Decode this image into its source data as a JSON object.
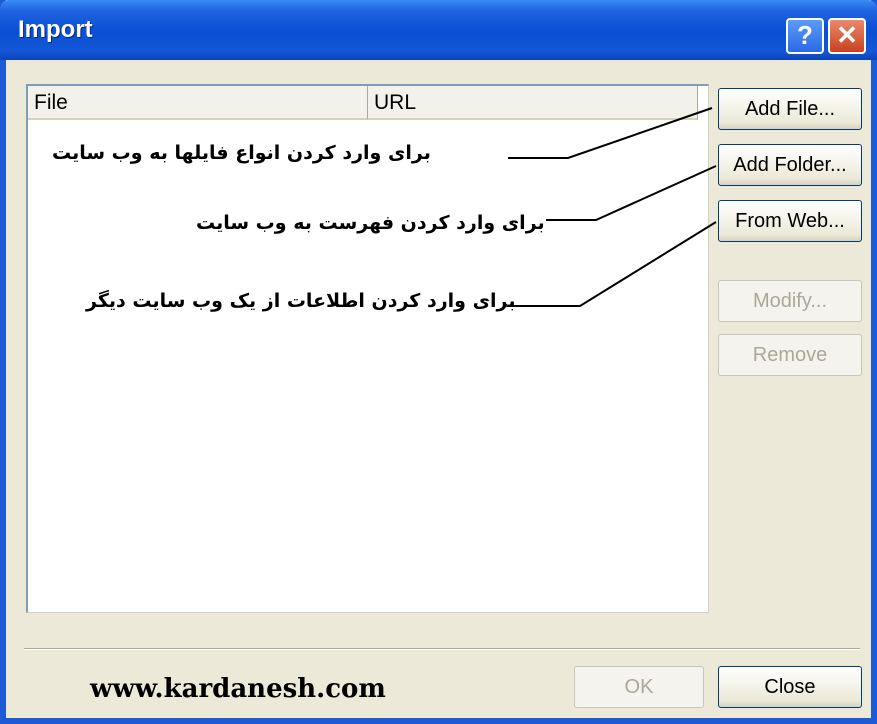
{
  "window": {
    "title": "Import"
  },
  "titlebar": {
    "help_label": "?",
    "close_label": "✕"
  },
  "list": {
    "columns": [
      "File",
      "URL"
    ]
  },
  "buttons": {
    "add_file": "Add File...",
    "add_folder": "Add Folder...",
    "from_web": "From Web...",
    "modify": "Modify...",
    "remove": "Remove",
    "ok": "OK",
    "close": "Close"
  },
  "annotations": {
    "add_file": "برای وارد کردن انواع فایلها به وب سایت",
    "add_folder": "برای وارد کردن فهرست به وب سایت",
    "from_web": "برای وارد کردن اطلاعات از یک وب سایت دیگر"
  },
  "footer": {
    "website": "www.kardanesh.com"
  }
}
